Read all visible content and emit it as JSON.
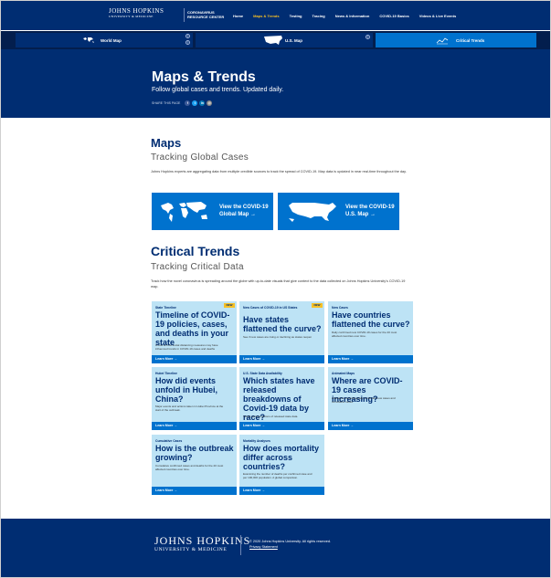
{
  "header": {
    "logo_main": "JOHNS HOPKINS",
    "logo_sub": "UNIVERSITY & MEDICINE",
    "center_line1": "CORONAVIRUS",
    "center_line2": "RESOURCE CENTER",
    "nav": [
      {
        "label": "Home",
        "active": false
      },
      {
        "label": "Maps & Trends",
        "active": true
      },
      {
        "label": "Testing",
        "active": false
      },
      {
        "label": "Tracing",
        "active": false
      },
      {
        "label": "News & Information",
        "active": false
      },
      {
        "label": "COVID-19 Basics",
        "active": false
      },
      {
        "label": "Videos & Live Events",
        "active": false
      }
    ]
  },
  "tabs": [
    {
      "label": "World Map",
      "icon": "world-map-icon"
    },
    {
      "label": "U.S. Map",
      "icon": "us-map-icon"
    },
    {
      "label": "Critical Trends",
      "icon": "trend-line-icon",
      "active": true
    }
  ],
  "hero": {
    "title": "Maps & Trends",
    "subtitle": "Follow global cases and trends. Updated daily.",
    "share_label": "SHARE THIS PAGE"
  },
  "maps": {
    "heading": "Maps",
    "subheading": "Tracking Global Cases",
    "text": "Johns Hopkins experts are aggregating data from multiple credible sources to track the spread of COVID-19. Map data is updated in near real-time throughout the day.",
    "global_button": {
      "line1": "View the COVID-19",
      "line2": "Global Map →"
    },
    "us_button": {
      "line1": "View the COVID-19",
      "line2": "U.S. Map →"
    }
  },
  "trends": {
    "heading": "Critical Trends",
    "subheading": "Tracking Critical Data",
    "text": "Track how the novel coronavirus is spreading around the globe with up-to-date visuals that give context to the data collected on Johns Hopkins University's COVID-19 map.",
    "learn_more": "Learn More →",
    "new_badge": "NEW",
    "cards": [
      {
        "kicker": "State Timeline",
        "title": "Timeline of COVID-19 policies, cases, and deaths in your state",
        "desc": "A look at how social distancing measures may have influenced trends in COVID-19 cases and deaths",
        "new": true
      },
      {
        "kicker": "New Cases of COVID-19 in US States",
        "title": "Have states flattened the curve?",
        "desc": "See if new cases are rising or declining as states reopen",
        "new": true
      },
      {
        "kicker": "New Cases",
        "title": "Have countries flattened the curve?",
        "desc": "Daily confirmed new COVID-19 cases for the 20 most affected countries over time.",
        "new": false
      },
      {
        "kicker": "Hubei Timeline",
        "title": "How did events unfold in Hubei, China?",
        "desc": "Major events and actions taken in Hubei Province at the start of the outbreak.",
        "new": false
      },
      {
        "kicker": "U.S. State Data Availability",
        "title": "Which states have released breakdowns of Covid-19 data by race?",
        "desc": "Visual representations of released state data.",
        "new": false
      },
      {
        "kicker": "Animated Maps",
        "title": "Where are COVID-19 cases increasing?",
        "desc": "Animations depicting daily confirmed new cases and cumulative cases.",
        "new": false
      },
      {
        "kicker": "Cumulative Cases",
        "title": "How is the outbreak growing?",
        "desc": "Cumulative confirmed cases and deaths for the 20 most affected countries over time.",
        "new": false
      },
      {
        "kicker": "Mortality Analyses",
        "title": "How does mortality differ across countries?",
        "desc": "Examining the number of deaths per confirmed case and per 100,000 population. A global comparison.",
        "new": false
      }
    ]
  },
  "footer": {
    "logo_main": "JOHNS HOPKINS",
    "logo_sub": "UNIVERSITY & MEDICINE",
    "copyright": "© 2020 Johns Hopkins University. All rights reserved.",
    "privacy": "Privacy Statement"
  }
}
